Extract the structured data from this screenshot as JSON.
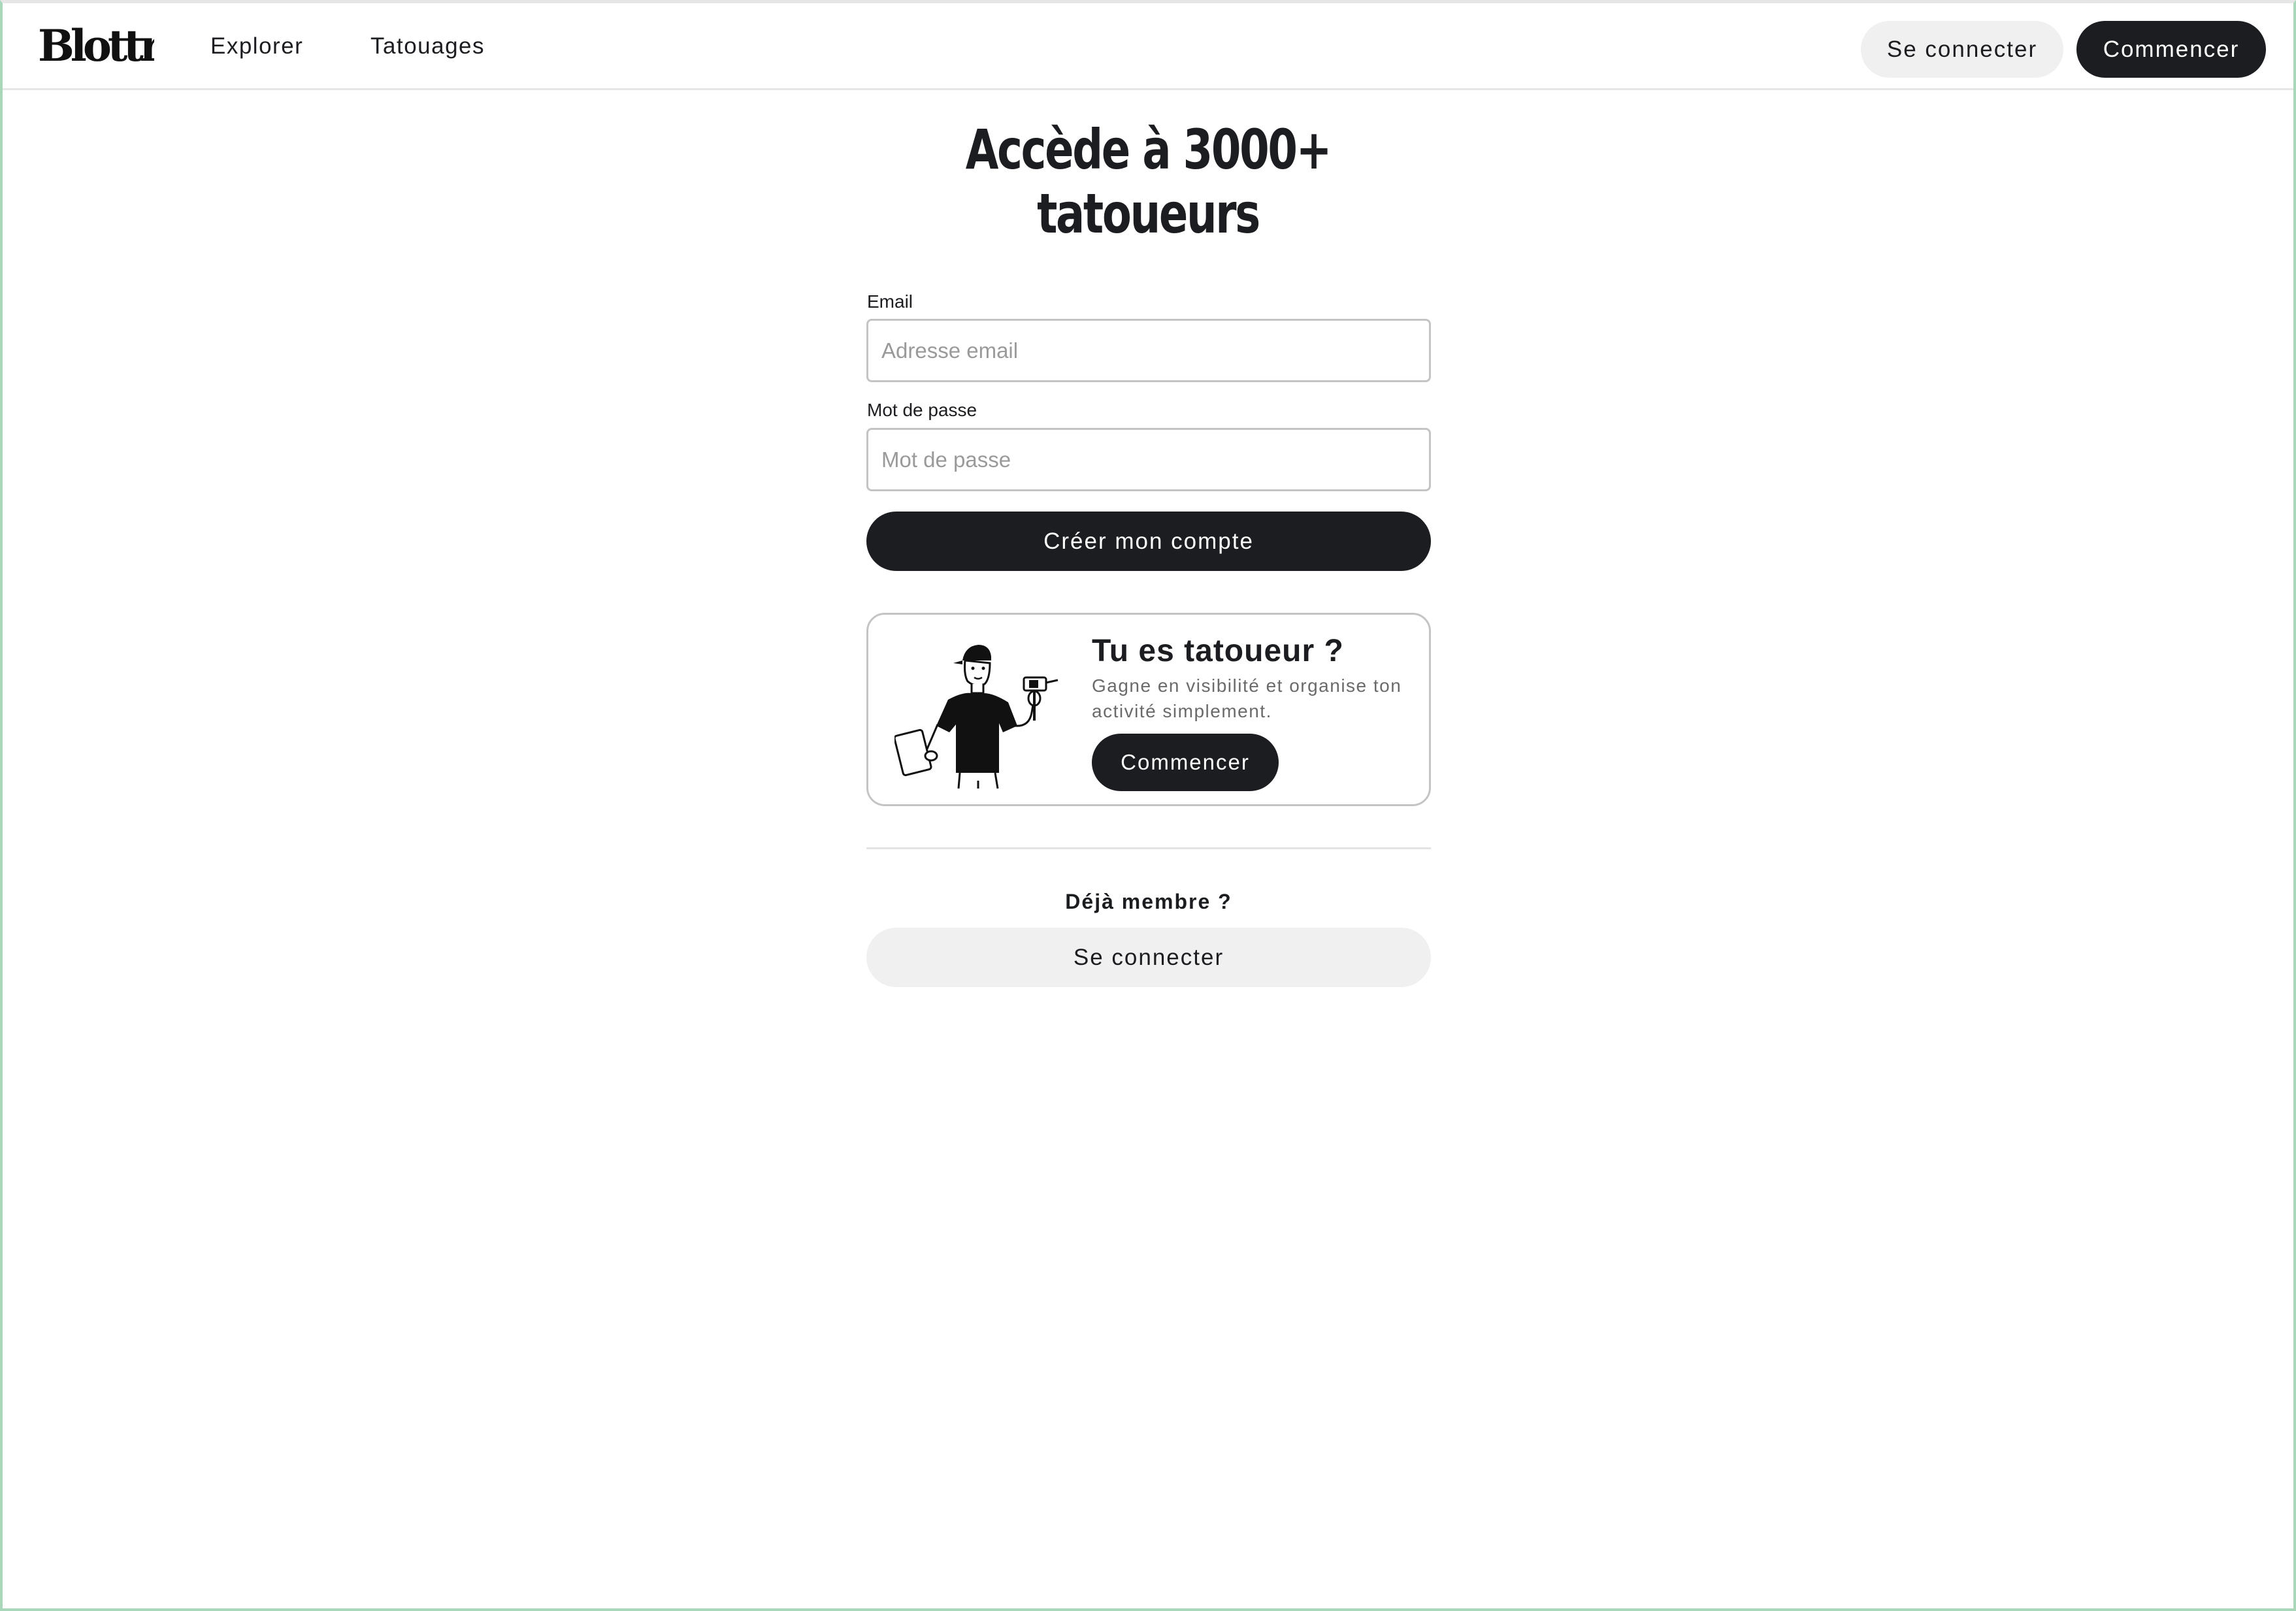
{
  "header": {
    "logo_text": "Blottr",
    "nav": [
      {
        "label": "Explorer"
      },
      {
        "label": "Tatouages"
      }
    ],
    "login_label": "Se connecter",
    "start_label": "Commencer"
  },
  "main": {
    "title_line1": "Accède à 3000+",
    "title_line2": "tatoueurs",
    "email_label": "Email",
    "email_placeholder": "Adresse email",
    "email_value": "",
    "password_label": "Mot de passe",
    "password_placeholder": "Mot de passe",
    "password_value": "",
    "create_label": "Créer mon compte"
  },
  "card": {
    "title": "Tu es tatoueur ?",
    "description": "Gagne en visibilité et organise ton activité simplement.",
    "button_label": "Commencer",
    "illustration": "tattoo-artist-illustration"
  },
  "footer": {
    "member_text": "Déjà membre ?",
    "login_label": "Se connecter"
  },
  "colors": {
    "primary_dark": "#1c1d20",
    "light_button": "#f0f0f0",
    "border": "#c4c4c4",
    "window_accent": "#a8d8b9"
  }
}
